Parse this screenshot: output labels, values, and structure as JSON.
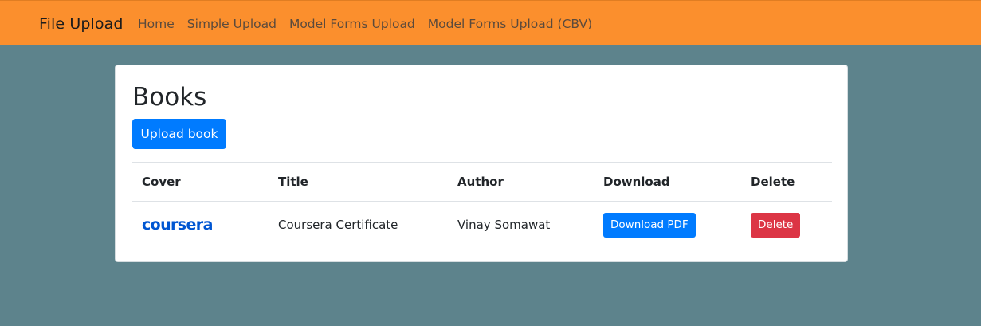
{
  "navbar": {
    "brand": "File Upload",
    "links": [
      "Home",
      "Simple Upload",
      "Model Forms Upload",
      "Model Forms Upload (CBV)"
    ],
    "bg_color": "#fb8f2d"
  },
  "page": {
    "title": "Books",
    "upload_button": "Upload book",
    "bg_color": "#5d838c"
  },
  "table": {
    "headers": [
      "Cover",
      "Title",
      "Author",
      "Download",
      "Delete"
    ],
    "rows": [
      {
        "cover_logo": "coursera",
        "title": "Coursera Certificate",
        "author": "Vinay Somawat",
        "download_label": "Download PDF",
        "delete_label": "Delete"
      }
    ]
  },
  "colors": {
    "primary": "#007bff",
    "danger": "#dc3545",
    "logo": "#0056d2"
  }
}
